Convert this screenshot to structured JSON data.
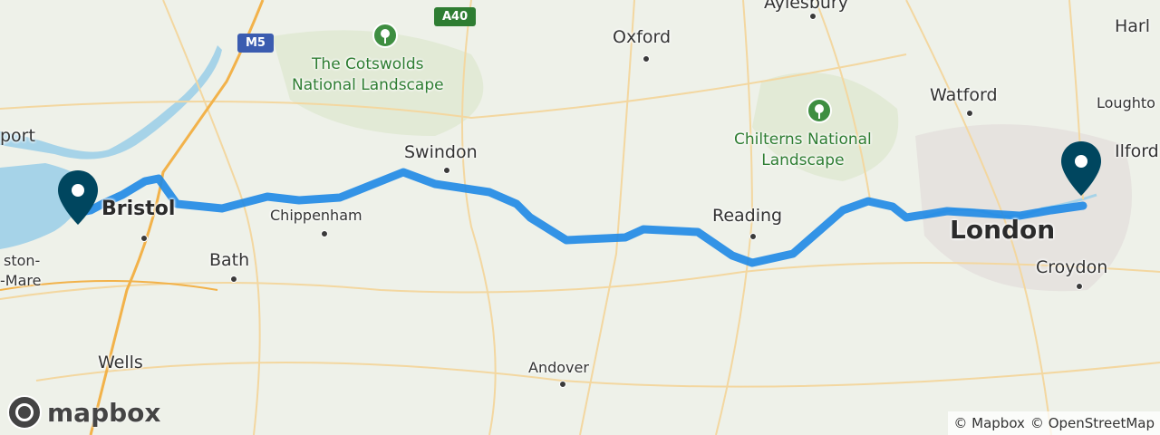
{
  "cities": [
    {
      "name": "Aylesbury",
      "cls": ""
    },
    {
      "name": "Harl",
      "cls": ""
    },
    {
      "name": "Oxford",
      "cls": ""
    },
    {
      "name": "Watford",
      "cls": ""
    },
    {
      "name": "Loughto",
      "cls": ""
    },
    {
      "name": "Ilford",
      "cls": ""
    },
    {
      "name": "port",
      "cls": ""
    },
    {
      "name": "Swindon",
      "cls": ""
    },
    {
      "name": "Bristol",
      "cls": ""
    },
    {
      "name": "Chippenham",
      "cls": ""
    },
    {
      "name": "Reading",
      "cls": ""
    },
    {
      "name": "London",
      "cls": "big"
    },
    {
      "name": "Bath",
      "cls": ""
    },
    {
      "name": "ston-",
      "cls": "small"
    },
    {
      "name": "-Mare",
      "cls": "small"
    },
    {
      "name": "Croydon",
      "cls": ""
    },
    {
      "name": "Wells",
      "cls": ""
    },
    {
      "name": "Andover",
      "cls": ""
    }
  ],
  "parks": [
    {
      "name": "The Cotswolds\nNational Landscape"
    },
    {
      "name": "Chilterns National\nLandscape"
    }
  ],
  "road_shields": [
    {
      "label": "A40",
      "type": "a"
    },
    {
      "label": "M5",
      "type": "m"
    }
  ],
  "route": {
    "color": "#1e88e5",
    "start": "Bristol",
    "end": "London"
  },
  "markers": [
    {
      "name": "start-marker",
      "color": "#00465f"
    },
    {
      "name": "end-marker",
      "color": "#00465f"
    }
  ],
  "logo": {
    "text": "mapbox"
  },
  "attribution": {
    "mapbox": "© Mapbox",
    "osm": "© OpenStreetMap"
  }
}
